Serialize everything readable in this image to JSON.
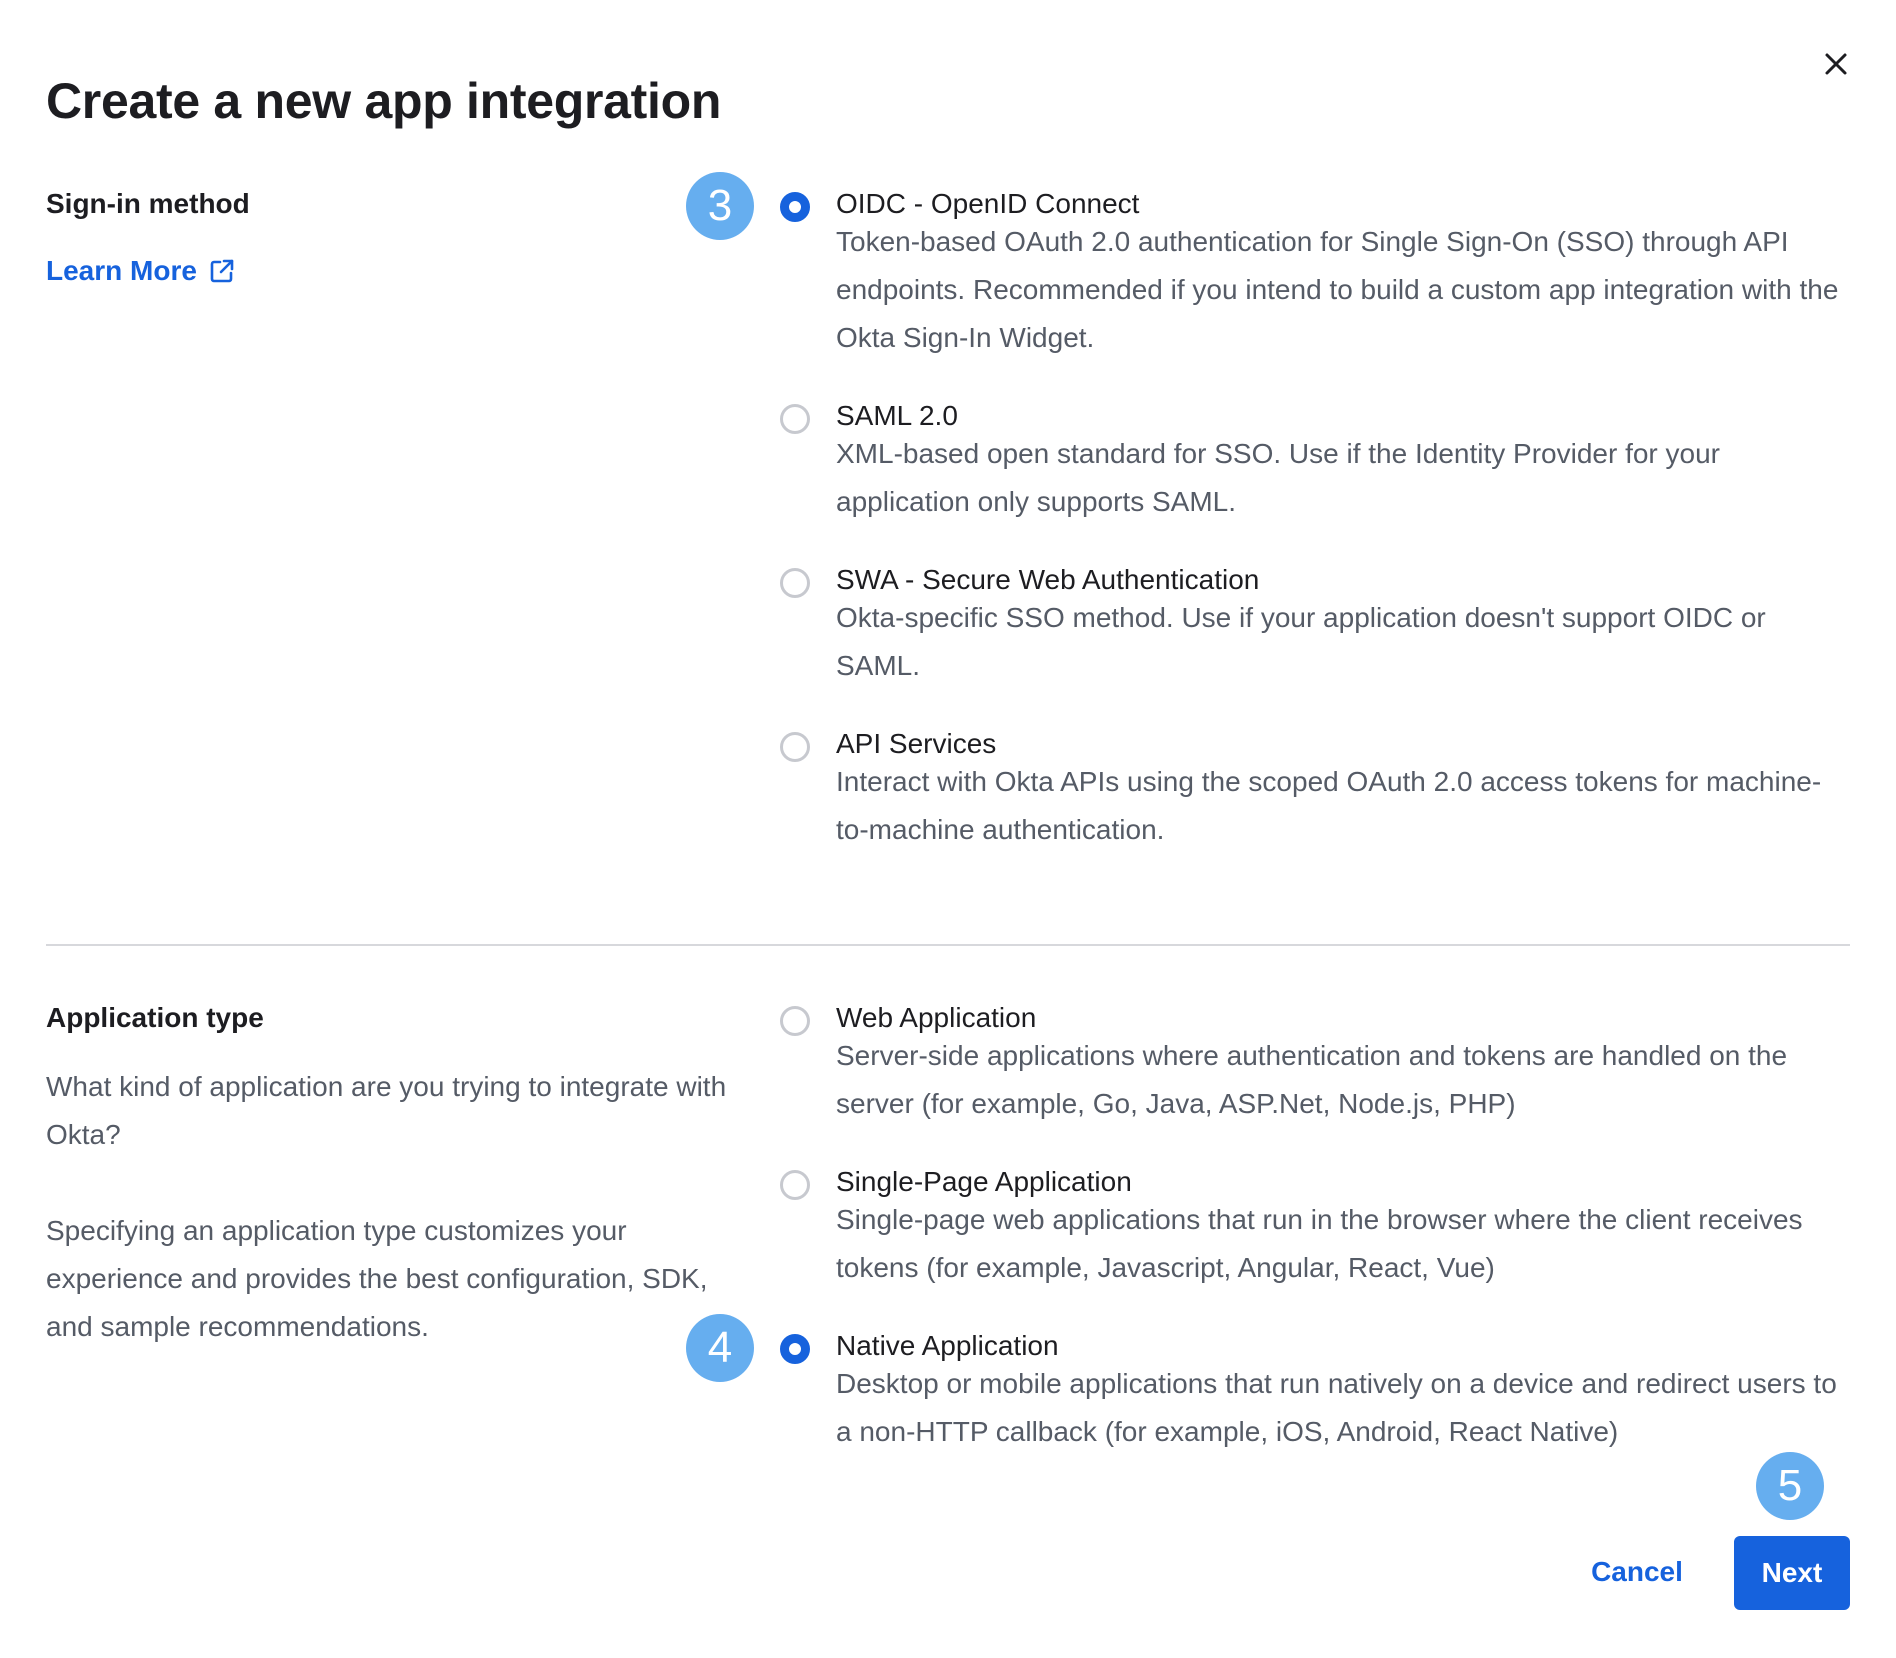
{
  "dialog": {
    "title": "Create a new app integration",
    "close_label": "×"
  },
  "sign_in": {
    "label": "Sign-in method",
    "learn_more": "Learn More",
    "options": [
      {
        "title": "OIDC - OpenID Connect",
        "description": "Token-based OAuth 2.0 authentication for Single Sign-On (SSO) through API endpoints. Recommended if you intend to build a custom app integration with the Okta Sign-In Widget.",
        "checked": true
      },
      {
        "title": "SAML 2.0",
        "description": "XML-based open standard for SSO. Use if the Identity Provider for your application only supports SAML.",
        "checked": false
      },
      {
        "title": "SWA - Secure Web Authentication",
        "description": "Okta-specific SSO method. Use if your application doesn't support OIDC or SAML.",
        "checked": false
      },
      {
        "title": "API Services",
        "description": "Interact with Okta APIs using the scoped OAuth 2.0 access tokens for machine-to-machine authentication.",
        "checked": false
      }
    ]
  },
  "app_type": {
    "label": "Application type",
    "question": "What kind of application are you trying to integrate with Okta?",
    "explanation": "Specifying an application type customizes your experience and provides the best configuration, SDK, and sample recommendations.",
    "options": [
      {
        "title": "Web Application",
        "description": "Server-side applications where authentication and tokens are handled on the server (for example, Go, Java, ASP.Net, Node.js, PHP)",
        "checked": false
      },
      {
        "title": "Single-Page Application",
        "description": "Single-page web applications that run in the browser where the client receives tokens (for example, Javascript, Angular, React, Vue)",
        "checked": false
      },
      {
        "title": "Native Application",
        "description": "Desktop or mobile applications that run natively on a device and redirect users to a non-HTTP callback (for example, iOS, Android, React Native)",
        "checked": true
      }
    ]
  },
  "steps": {
    "step_3": "3",
    "step_4": "4",
    "step_5": "5"
  },
  "footer": {
    "cancel_label": "Cancel",
    "next_label": "Next"
  },
  "colors": {
    "accent": "#1662dd",
    "step_badge": "#66aeef",
    "text": "#1d1d21",
    "muted_text": "#555b66"
  }
}
